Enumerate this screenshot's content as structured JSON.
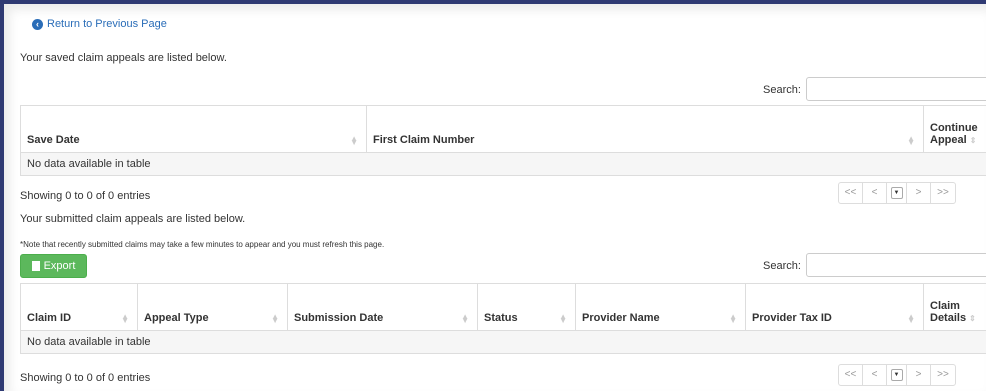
{
  "return_link": "Return to Previous Page",
  "saved_intro": "Your saved claim appeals are listed below.",
  "search_label": "Search:",
  "saved_table": {
    "headers": [
      "Save Date",
      "First Claim Number",
      "Continue",
      "Appeal"
    ],
    "empty": "No data available in table"
  },
  "saved_info": "Showing 0 to 0 of 0 entries",
  "submitted_intro": "Your submitted claim appeals are listed below.",
  "note": "*Note that recently submitted claims may take a few minutes to appear and you must refresh this page.",
  "export_label": "Export",
  "submitted_table": {
    "headers": [
      "Claim ID",
      "Appeal Type",
      "Submission Date",
      "Status",
      "Provider Name",
      "Provider Tax ID",
      "Claim",
      "Details"
    ],
    "empty": "No data available in table"
  },
  "submitted_info": "Showing 0 to 0 of 0 entries",
  "pager": [
    "<<",
    "<",
    ">",
    ">>"
  ]
}
